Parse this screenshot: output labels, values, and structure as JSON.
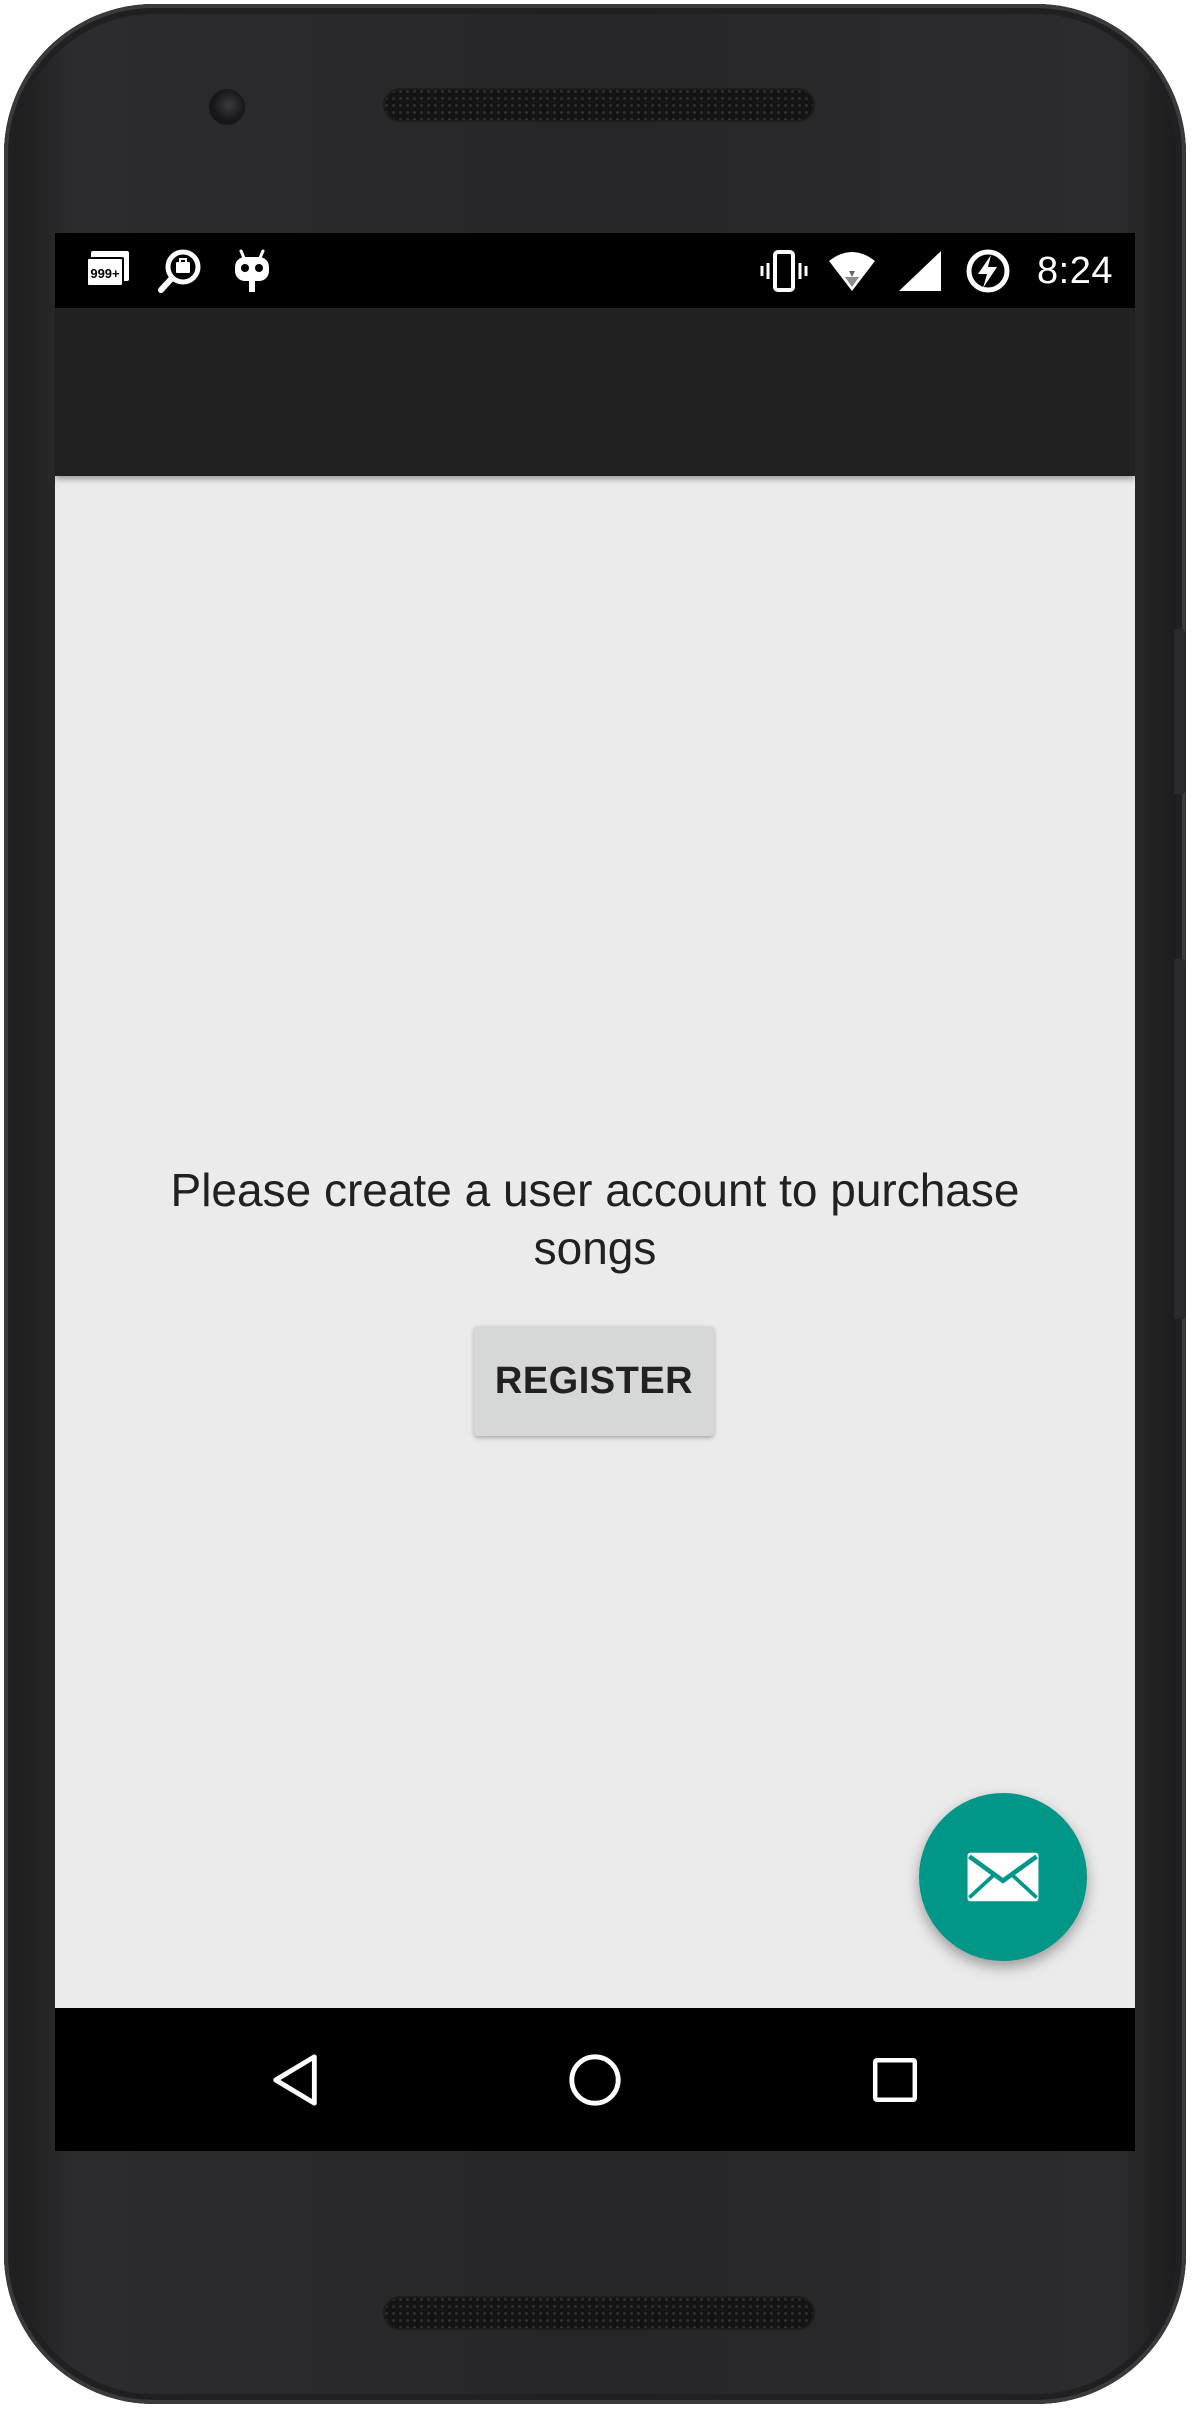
{
  "status_bar": {
    "time": "8:24",
    "notification_badge": "999+",
    "left_icons": [
      "image-stack-icon",
      "search-briefcase-icon",
      "cyanogen-bugdroid-icon"
    ],
    "right_icons": [
      "vibrate-icon",
      "wifi-icon",
      "cell-signal-icon",
      "battery-saver-icon"
    ]
  },
  "main": {
    "message": "Please create a user account to purchase songs",
    "register_label": "REGISTER"
  },
  "fab": {
    "icon": "mail-icon",
    "color": "#009688"
  },
  "nav_bar": {
    "buttons": [
      "back-icon",
      "home-icon",
      "recents-icon"
    ]
  },
  "colors": {
    "app_bar": "#212121",
    "content_bg": "#ebebeb",
    "button_bg": "#d6d7d7",
    "accent": "#009688"
  }
}
